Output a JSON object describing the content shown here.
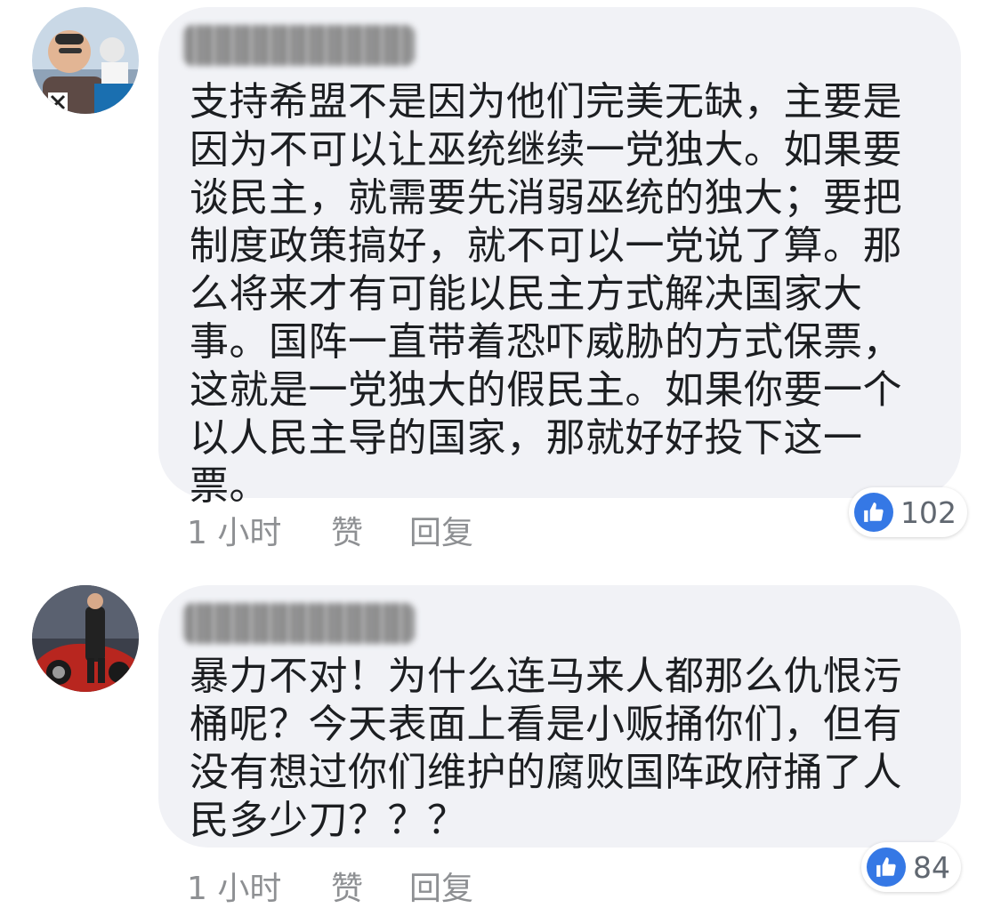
{
  "comments": [
    {
      "text": "支持希盟不是因为他们完美无缺，主要是因为不可以让巫统继续一党独大。如果要谈民主，就需要先消弱巫统的独大；要把制度政策搞好，就不可以一党说了算。那么将来才有可能以民主方式解决国家大事。国阵一直带着恐吓威胁的方式保票，这就是一党独大的假民主。如果你要一个以人民主导的国家，那就好好投下这一票。",
      "time": "1 小时",
      "like_label": "赞",
      "reply_label": "回复",
      "reaction_count": "102",
      "reaction_icon": "thumbs-up-icon",
      "reaction_color": "#3578e5"
    },
    {
      "text": "暴力不对！为什么连马来人都那么仇恨污桶呢？今天表面上看是小贩捅你们，但有没有想过你们维护的腐败国阵政府捅了人民多少刀？？？",
      "time": "1 小时",
      "like_label": "赞",
      "reply_label": "回复",
      "reaction_count": "84",
      "reaction_icon": "thumbs-up-icon",
      "reaction_color": "#3578e5"
    }
  ],
  "colors": {
    "bubble": "#f1f2f6",
    "text": "#1c1e21",
    "meta": "#8e9093",
    "like_blue": "#3578e5"
  }
}
